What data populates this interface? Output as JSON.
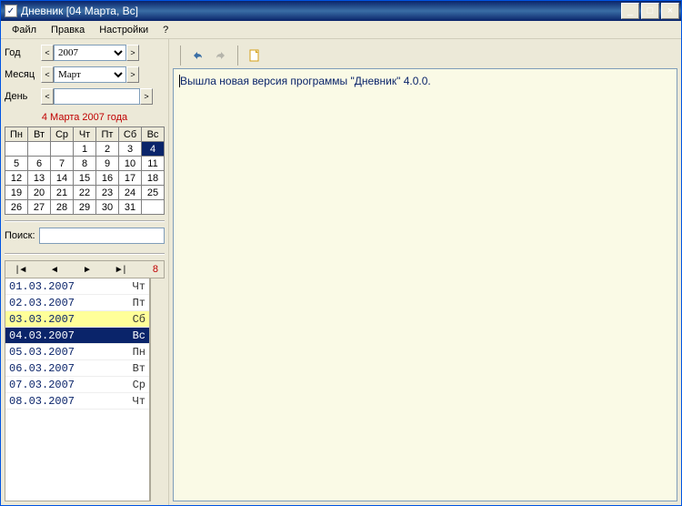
{
  "title": "Дневник  [04 Марта, Вс]",
  "menu": {
    "file": "Файл",
    "edit": "Правка",
    "settings": "Настройки",
    "help": "?"
  },
  "labels": {
    "year": "Год",
    "month": "Месяц",
    "day": "День",
    "search": "Поиск:"
  },
  "year_value": "2007",
  "month_value": "Март",
  "day_value": "",
  "calendar_header": "4 Марта 2007 года",
  "weekdays": [
    "Пн",
    "Вт",
    "Ср",
    "Чт",
    "Пт",
    "Сб",
    "Вс"
  ],
  "calendar": [
    [
      "",
      "",
      "",
      "1",
      "2",
      "3",
      "4"
    ],
    [
      "5",
      "6",
      "7",
      "8",
      "9",
      "10",
      "11"
    ],
    [
      "12",
      "13",
      "14",
      "15",
      "16",
      "17",
      "18"
    ],
    [
      "19",
      "20",
      "21",
      "22",
      "23",
      "24",
      "25"
    ],
    [
      "26",
      "27",
      "28",
      "29",
      "30",
      "31",
      ""
    ]
  ],
  "selected_day": "4",
  "entry_count": "8",
  "entries": [
    {
      "date": "01.03.2007",
      "dow": "Чт",
      "cls": ""
    },
    {
      "date": "02.03.2007",
      "dow": "Пт",
      "cls": ""
    },
    {
      "date": "03.03.2007",
      "dow": "Сб",
      "cls": "sat"
    },
    {
      "date": "04.03.2007",
      "dow": "Вс",
      "cls": "sel"
    },
    {
      "date": "05.03.2007",
      "dow": "Пн",
      "cls": ""
    },
    {
      "date": "06.03.2007",
      "dow": "Вт",
      "cls": ""
    },
    {
      "date": "07.03.2007",
      "dow": "Ср",
      "cls": ""
    },
    {
      "date": "08.03.2007",
      "dow": "Чт",
      "cls": ""
    }
  ],
  "editor_text": "Вышла новая версия программы \"Дневник\" 4.0.0."
}
